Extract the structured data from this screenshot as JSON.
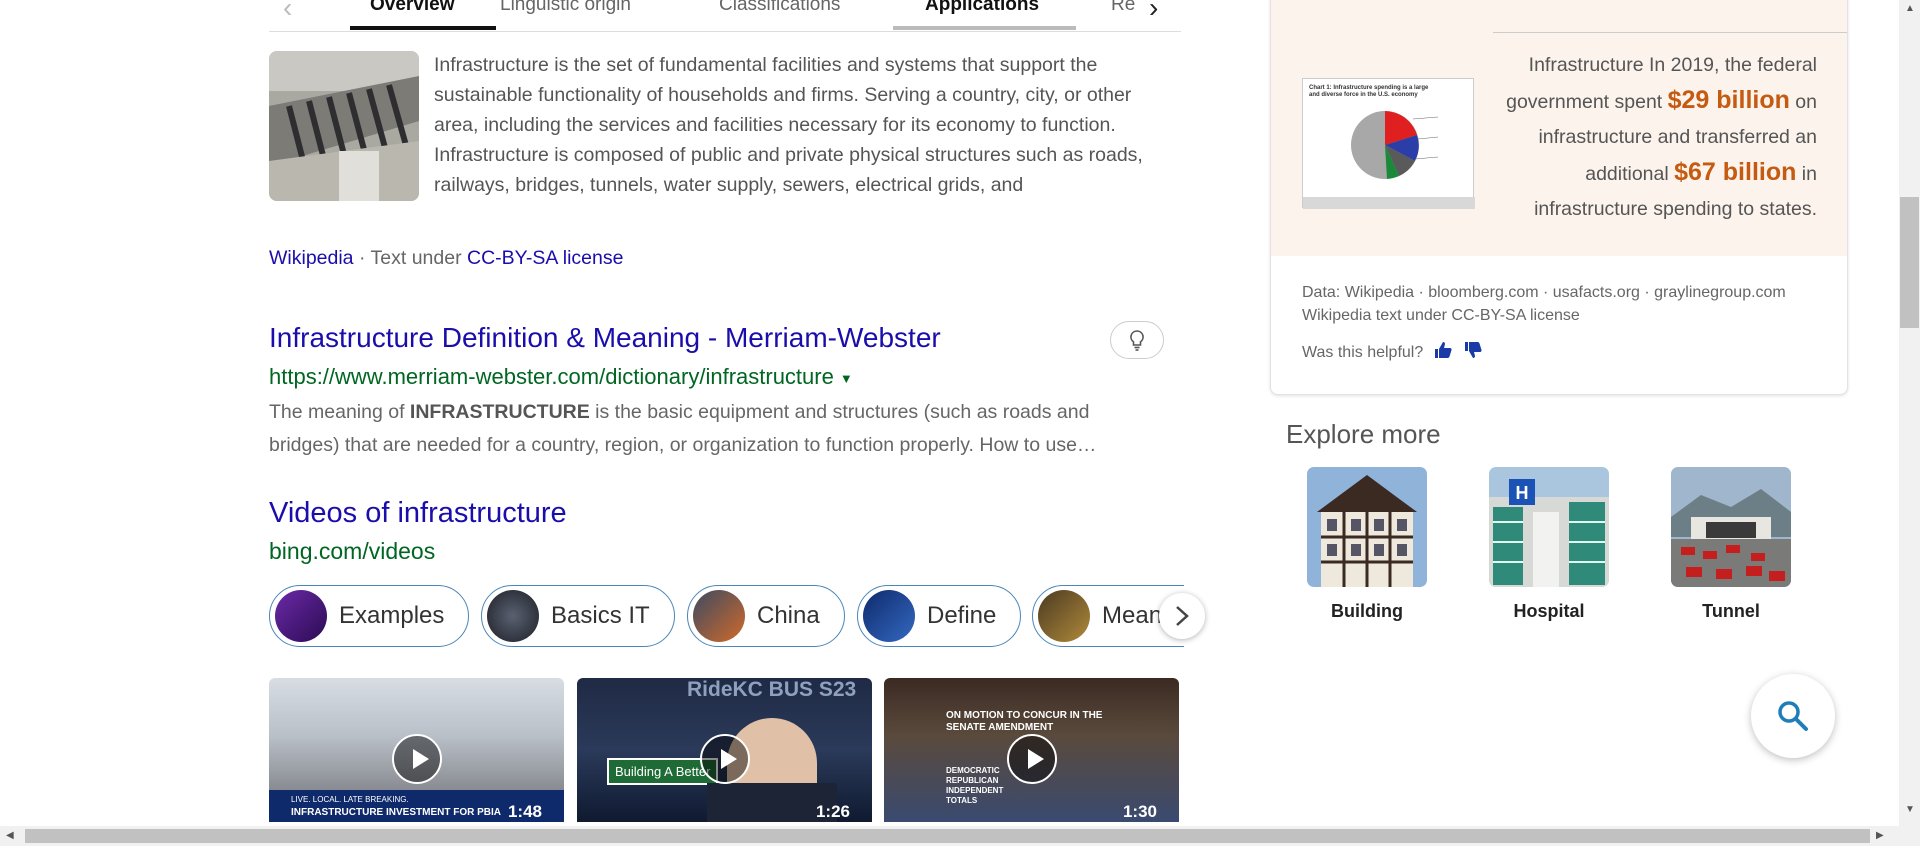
{
  "tabs": [
    "Overview",
    "Linguistic origin",
    "Classifications",
    "Applications",
    "Re"
  ],
  "wiki": {
    "text": "Infrastructure is the set of fundamental facilities and systems that support the sustainable functionality of households and firms. Serving a country, city, or other area, including the services and facilities necessary for its economy to function. Infrastructure is composed of public and private physical structures such as roads, railways, bridges, tunnels, water supply, sewers, electrical grids, and",
    "source": "Wikipedia",
    "license_prefix": "· Text under",
    "license": "CC-BY-SA license"
  },
  "result": {
    "title": "Infrastructure Definition & Meaning - Merriam-Webster",
    "url": "https://www.merriam-webster.com/dictionary/infrastructure",
    "snippet_pre": "The meaning of ",
    "snippet_bold": "INFRASTRUCTURE",
    "snippet_post": " is the basic equipment and structures (such as roads and bridges) that are needed for a country, region, or organization to function properly. How to use…"
  },
  "videos": {
    "title": "Videos of infrastructure",
    "url": "bing.com/videos",
    "chips": [
      "Examples",
      "Basics IT",
      "China",
      "Define",
      "Meaning"
    ],
    "items": [
      {
        "duration": "1:48",
        "caption": "INFRASTRUCTURE INVESTMENT FOR PBIA",
        "top_caption": "LIVE. LOCAL. LATE BREAKING."
      },
      {
        "duration": "1:26",
        "caption": "Building A Better",
        "top_caption": "RideKC BUS S23"
      },
      {
        "duration": "1:30",
        "caption": "ON MOTION TO CONCUR IN THE SENATE AMENDMENT",
        "top_caption": "DEMOCRATIC REPUBLICAN INDEPENDENT TOTALS"
      }
    ]
  },
  "panel": {
    "fact_pre": "Infrastructure In 2019, the federal government spent ",
    "fact_big1": "$29 billion",
    "fact_mid": " on infrastructure and transferred an additional ",
    "fact_big2": "$67 billion",
    "fact_post": " in infrastructure spending to states.",
    "chart_caption": "Chart 1: Infrastructure spending is a large and diverse force in the U.S. economy",
    "data_sources": "Data: Wikipedia · bloomberg.com · usafacts.org · graylinegroup.com",
    "license_note": "Wikipedia text under CC-BY-SA license",
    "helpful": "Was this helpful?"
  },
  "explore": {
    "title": "Explore more",
    "items": [
      "Building",
      "Hospital",
      "Tunnel"
    ]
  },
  "colors": {
    "link": "#1a0dab",
    "url": "#006621",
    "highlight": "#c55a11",
    "panel_bg": "#fbf3ec"
  }
}
